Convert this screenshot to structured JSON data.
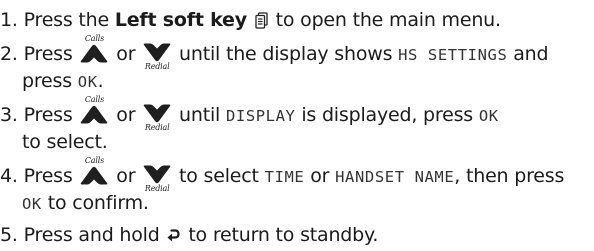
{
  "steps": [
    {
      "num": "1.",
      "t1": "Press the ",
      "bold": "Left soft key",
      "t2": " to open the main menu."
    },
    {
      "num": "2.",
      "t1": "Press",
      "or": "or",
      "t2": "until the display shows",
      "lcd1": "HS SETTINGS",
      "t3": "and",
      "t4": "press",
      "lcd2": "OK",
      "t5": "."
    },
    {
      "num": "3.",
      "t1": "Press",
      "or": "or",
      "t2": "until",
      "lcd1": "DISPLAY",
      "t3": "is displayed, press",
      "lcd2": "OK",
      "t4": "to select."
    },
    {
      "num": "4.",
      "t1": "Press",
      "or": "or",
      "t2": "to select",
      "lcd1": "TIME",
      "t3": "or",
      "lcd2": "HANDSET NAME",
      "t4": ", then press",
      "lcd3": "OK",
      "t5": "to confirm."
    },
    {
      "num": "5.",
      "t1": "Press and hold",
      "t2": "to return to standby."
    }
  ],
  "keys": {
    "up_label": "Calls",
    "down_label": "Redial"
  },
  "icons": {
    "up_key": "calls-up-arrow-key-icon",
    "down_key": "redial-down-arrow-key-icon",
    "soft_key": "left-soft-key-menu-icon",
    "back_key": "back-end-key-icon"
  },
  "colors": {
    "arrow_key": "#1f1f1f",
    "text": "#1b1b1b"
  }
}
